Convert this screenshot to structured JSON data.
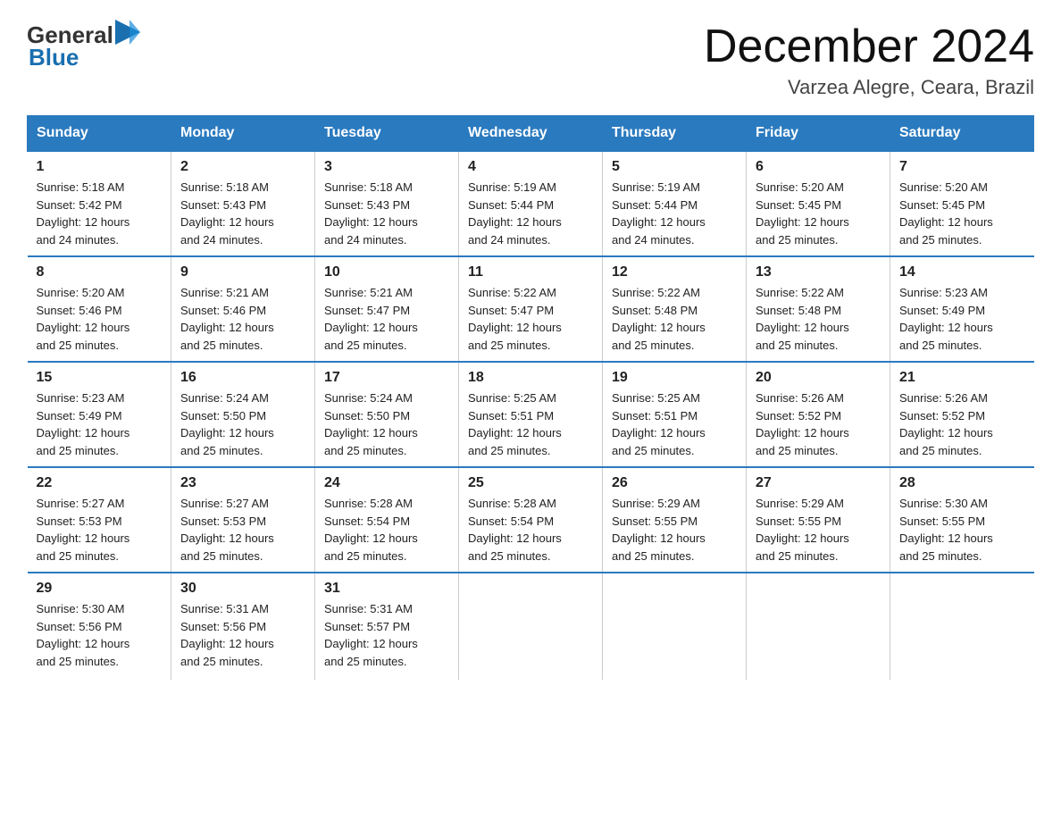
{
  "logo": {
    "text_general": "General",
    "text_blue": "Blue",
    "arrow_color": "#1a6faf"
  },
  "header": {
    "month": "December 2024",
    "location": "Varzea Alegre, Ceara, Brazil"
  },
  "days_of_week": [
    "Sunday",
    "Monday",
    "Tuesday",
    "Wednesday",
    "Thursday",
    "Friday",
    "Saturday"
  ],
  "weeks": [
    [
      {
        "day": "1",
        "sunrise": "5:18 AM",
        "sunset": "5:42 PM",
        "daylight": "12 hours and 24 minutes."
      },
      {
        "day": "2",
        "sunrise": "5:18 AM",
        "sunset": "5:43 PM",
        "daylight": "12 hours and 24 minutes."
      },
      {
        "day": "3",
        "sunrise": "5:18 AM",
        "sunset": "5:43 PM",
        "daylight": "12 hours and 24 minutes."
      },
      {
        "day": "4",
        "sunrise": "5:19 AM",
        "sunset": "5:44 PM",
        "daylight": "12 hours and 24 minutes."
      },
      {
        "day": "5",
        "sunrise": "5:19 AM",
        "sunset": "5:44 PM",
        "daylight": "12 hours and 24 minutes."
      },
      {
        "day": "6",
        "sunrise": "5:20 AM",
        "sunset": "5:45 PM",
        "daylight": "12 hours and 25 minutes."
      },
      {
        "day": "7",
        "sunrise": "5:20 AM",
        "sunset": "5:45 PM",
        "daylight": "12 hours and 25 minutes."
      }
    ],
    [
      {
        "day": "8",
        "sunrise": "5:20 AM",
        "sunset": "5:46 PM",
        "daylight": "12 hours and 25 minutes."
      },
      {
        "day": "9",
        "sunrise": "5:21 AM",
        "sunset": "5:46 PM",
        "daylight": "12 hours and 25 minutes."
      },
      {
        "day": "10",
        "sunrise": "5:21 AM",
        "sunset": "5:47 PM",
        "daylight": "12 hours and 25 minutes."
      },
      {
        "day": "11",
        "sunrise": "5:22 AM",
        "sunset": "5:47 PM",
        "daylight": "12 hours and 25 minutes."
      },
      {
        "day": "12",
        "sunrise": "5:22 AM",
        "sunset": "5:48 PM",
        "daylight": "12 hours and 25 minutes."
      },
      {
        "day": "13",
        "sunrise": "5:22 AM",
        "sunset": "5:48 PM",
        "daylight": "12 hours and 25 minutes."
      },
      {
        "day": "14",
        "sunrise": "5:23 AM",
        "sunset": "5:49 PM",
        "daylight": "12 hours and 25 minutes."
      }
    ],
    [
      {
        "day": "15",
        "sunrise": "5:23 AM",
        "sunset": "5:49 PM",
        "daylight": "12 hours and 25 minutes."
      },
      {
        "day": "16",
        "sunrise": "5:24 AM",
        "sunset": "5:50 PM",
        "daylight": "12 hours and 25 minutes."
      },
      {
        "day": "17",
        "sunrise": "5:24 AM",
        "sunset": "5:50 PM",
        "daylight": "12 hours and 25 minutes."
      },
      {
        "day": "18",
        "sunrise": "5:25 AM",
        "sunset": "5:51 PM",
        "daylight": "12 hours and 25 minutes."
      },
      {
        "day": "19",
        "sunrise": "5:25 AM",
        "sunset": "5:51 PM",
        "daylight": "12 hours and 25 minutes."
      },
      {
        "day": "20",
        "sunrise": "5:26 AM",
        "sunset": "5:52 PM",
        "daylight": "12 hours and 25 minutes."
      },
      {
        "day": "21",
        "sunrise": "5:26 AM",
        "sunset": "5:52 PM",
        "daylight": "12 hours and 25 minutes."
      }
    ],
    [
      {
        "day": "22",
        "sunrise": "5:27 AM",
        "sunset": "5:53 PM",
        "daylight": "12 hours and 25 minutes."
      },
      {
        "day": "23",
        "sunrise": "5:27 AM",
        "sunset": "5:53 PM",
        "daylight": "12 hours and 25 minutes."
      },
      {
        "day": "24",
        "sunrise": "5:28 AM",
        "sunset": "5:54 PM",
        "daylight": "12 hours and 25 minutes."
      },
      {
        "day": "25",
        "sunrise": "5:28 AM",
        "sunset": "5:54 PM",
        "daylight": "12 hours and 25 minutes."
      },
      {
        "day": "26",
        "sunrise": "5:29 AM",
        "sunset": "5:55 PM",
        "daylight": "12 hours and 25 minutes."
      },
      {
        "day": "27",
        "sunrise": "5:29 AM",
        "sunset": "5:55 PM",
        "daylight": "12 hours and 25 minutes."
      },
      {
        "day": "28",
        "sunrise": "5:30 AM",
        "sunset": "5:55 PM",
        "daylight": "12 hours and 25 minutes."
      }
    ],
    [
      {
        "day": "29",
        "sunrise": "5:30 AM",
        "sunset": "5:56 PM",
        "daylight": "12 hours and 25 minutes."
      },
      {
        "day": "30",
        "sunrise": "5:31 AM",
        "sunset": "5:56 PM",
        "daylight": "12 hours and 25 minutes."
      },
      {
        "day": "31",
        "sunrise": "5:31 AM",
        "sunset": "5:57 PM",
        "daylight": "12 hours and 25 minutes."
      },
      {
        "day": "",
        "sunrise": "",
        "sunset": "",
        "daylight": ""
      },
      {
        "day": "",
        "sunrise": "",
        "sunset": "",
        "daylight": ""
      },
      {
        "day": "",
        "sunrise": "",
        "sunset": "",
        "daylight": ""
      },
      {
        "day": "",
        "sunrise": "",
        "sunset": "",
        "daylight": ""
      }
    ]
  ],
  "labels": {
    "sunrise_prefix": "Sunrise: ",
    "sunset_prefix": "Sunset: ",
    "daylight_prefix": "Daylight: "
  }
}
